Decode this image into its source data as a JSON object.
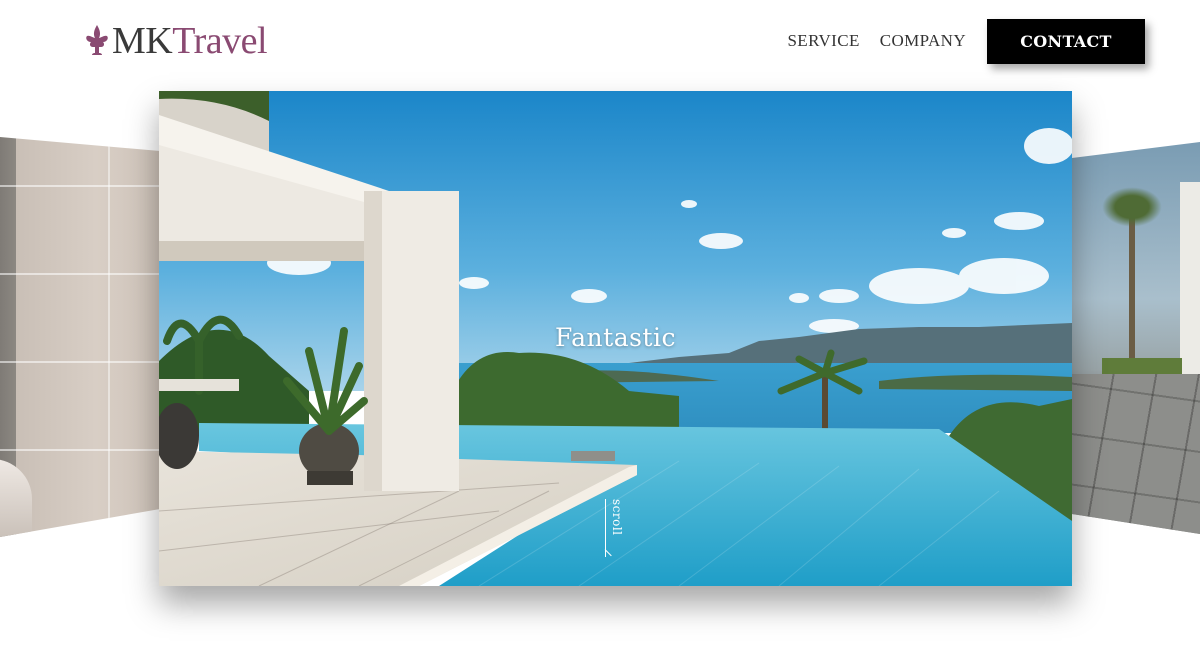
{
  "brand": {
    "logo_part1": "MK",
    "logo_part2": "Travel",
    "logo_icon": "fleur-de-lis-icon",
    "primary_color": "#8a4a72"
  },
  "nav": {
    "service_label": "SERVICE",
    "company_label": "COMPANY",
    "contact_label": "CONTACT"
  },
  "hero": {
    "title": "Fantastic",
    "scroll_label": "scroll"
  },
  "colors": {
    "contact_bg": "#000000",
    "sky": "#1f8fd0",
    "pool": "#3fb6d8"
  }
}
